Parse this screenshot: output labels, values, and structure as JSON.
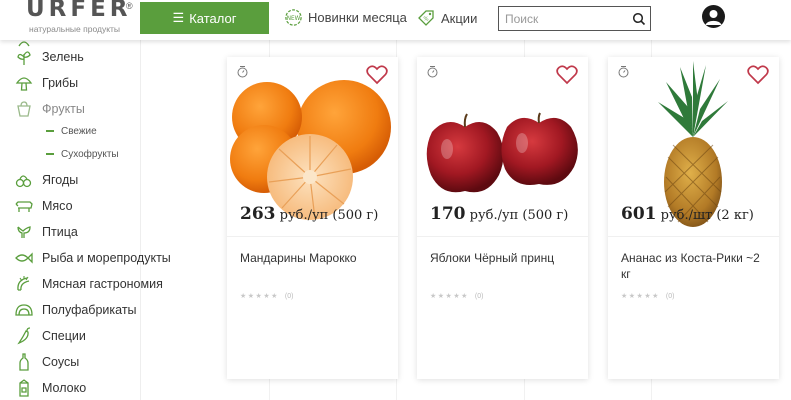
{
  "header": {
    "logo_text": "URFER",
    "logo_registered": "®",
    "logo_subtitle": "натуральные продукты",
    "catalog_label": "Каталог",
    "nav": [
      {
        "label": "Новинки месяца",
        "icon": "new-badge-icon"
      },
      {
        "label": "Акции",
        "icon": "discount-tag-icon"
      }
    ],
    "search_placeholder": "Поиск"
  },
  "sidebar": {
    "items": [
      {
        "label": "Зелень",
        "icon": "greens-icon"
      },
      {
        "label": "Грибы",
        "icon": "mushroom-icon"
      },
      {
        "label": "Фрукты",
        "icon": "fruit-icon",
        "active": true,
        "children": [
          {
            "label": "Свежие"
          },
          {
            "label": "Сухофрукты"
          }
        ]
      },
      {
        "label": "Ягоды",
        "icon": "berries-icon"
      },
      {
        "label": "Мясо",
        "icon": "cow-icon"
      },
      {
        "label": "Птица",
        "icon": "bird-icon"
      },
      {
        "label": "Рыба и морепродукты",
        "icon": "fish-icon"
      },
      {
        "label": "Мясная гастрономия",
        "icon": "sausage-icon"
      },
      {
        "label": "Полуфабрикаты",
        "icon": "dumplings-icon"
      },
      {
        "label": "Специи",
        "icon": "pepper-icon"
      },
      {
        "label": "Соусы",
        "icon": "bottle-icon"
      },
      {
        "label": "Молоко",
        "icon": "milk-icon"
      }
    ]
  },
  "products": [
    {
      "price_value": "263",
      "price_unit": "руб./уп (500 г)",
      "name": "Мандарины Марокко",
      "rating_count": "(0)",
      "image": "tangerines"
    },
    {
      "price_value": "170",
      "price_unit": "руб./уп (500 г)",
      "name": "Яблоки Чёрный принц",
      "rating_count": "(0)",
      "image": "red-apples"
    },
    {
      "price_value": "601",
      "price_unit": "руб./шт (2 кг)",
      "name": "Ананас из Коста-Рики ~2 кг",
      "rating_count": "(0)",
      "image": "pineapple"
    }
  ],
  "colors": {
    "accent_green": "#5a9e3d",
    "heart_red": "#c0394b",
    "text_dark": "#333333"
  }
}
